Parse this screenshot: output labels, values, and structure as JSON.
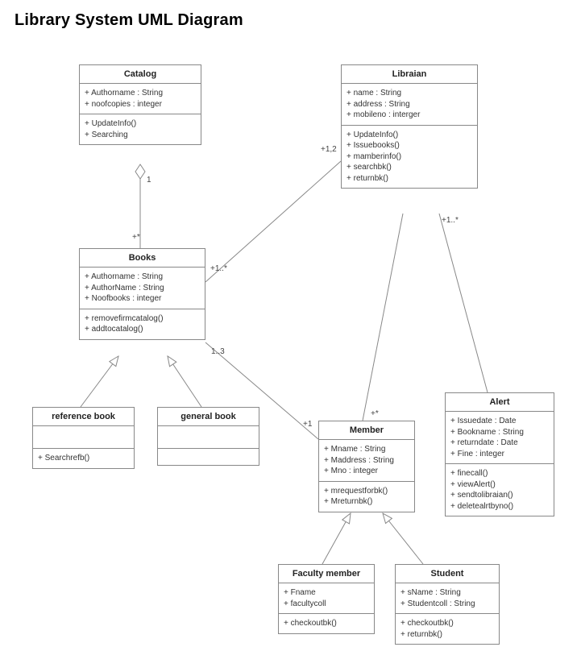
{
  "title": "Library System UML Diagram",
  "classes": {
    "catalog": {
      "name": "Catalog",
      "attrs": [
        "+  Authorname : String",
        "+  noofcopies : integer"
      ],
      "ops": [
        "+  UpdateInfo()",
        "+  Searching"
      ]
    },
    "librarian": {
      "name": "Libraian",
      "attrs": [
        "+  name : String",
        "+  address : String",
        "+  mobileno : interger"
      ],
      "ops": [
        "+  UpdateInfo()",
        "+  Issuebooks()",
        "+  mamberinfo()",
        "+  searchbk()",
        "+  returnbk()"
      ]
    },
    "books": {
      "name": "Books",
      "attrs": [
        "+  Authorname : String",
        "+  AuthorName : String",
        "+ Noofbooks : integer"
      ],
      "ops": [
        "+  removefirmcatalog()",
        "+  addtocatalog()"
      ]
    },
    "refbook": {
      "name": "reference book",
      "attrs": [],
      "ops": [
        "+  Searchrefb()"
      ]
    },
    "genbook": {
      "name": "general book",
      "attrs": [],
      "ops": []
    },
    "member": {
      "name": "Member",
      "attrs": [
        "+ Mname : String",
        "+ Maddress : String",
        "+ Mno : integer"
      ],
      "ops": [
        "+ mrequestforbk()",
        "+ Mreturnbk()"
      ]
    },
    "alert": {
      "name": "Alert",
      "attrs": [
        "+ Issuedate : Date",
        "+ Bookname : String",
        "+ returndate : Date",
        "+ Fine : integer"
      ],
      "ops": [
        "+ finecall()",
        "+ viewAlert()",
        "+ sendtolibraian()",
        "+ deletealrtbyno()"
      ]
    },
    "faculty": {
      "name": "Faculty member",
      "attrs": [
        "+ Fname",
        "+ facultycoll"
      ],
      "ops": [
        "+ checkoutbk()"
      ]
    },
    "student": {
      "name": "Student",
      "attrs": [
        "+ sName : String",
        "+ Studentcoll : String"
      ],
      "ops": [
        "+ checkoutbk()",
        "+ returnbk()"
      ]
    }
  },
  "multiplicities": {
    "cat_books_top": "1",
    "cat_books_bottom": "+*",
    "books_lib_near_books": "+1..*",
    "books_lib_near_lib": "+1,2",
    "books_member_near_books": "1..3",
    "books_member_near_member": "+1",
    "lib_member": "+*",
    "lib_alert": "+1..*"
  }
}
